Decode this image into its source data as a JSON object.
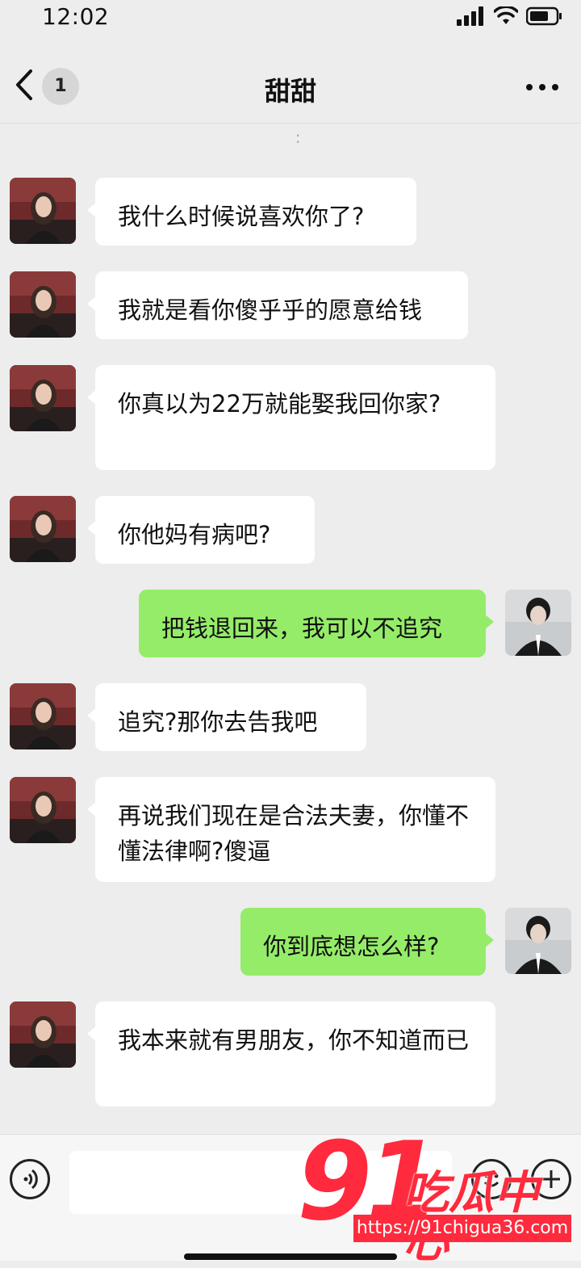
{
  "status_bar": {
    "time": "12:02"
  },
  "nav": {
    "title": "甜甜",
    "unread_count": "1"
  },
  "messages": [
    {
      "side": "left",
      "text": "我什么时候说喜欢你了?"
    },
    {
      "side": "left",
      "text": "我就是看你傻乎乎的愿意给钱"
    },
    {
      "side": "left",
      "text": "你真以为22万就能娶我回你家?"
    },
    {
      "side": "left",
      "text": "你他妈有病吧?"
    },
    {
      "side": "right",
      "text": "把钱退回来，我可以不追究"
    },
    {
      "side": "left",
      "text": "追究?那你去告我吧"
    },
    {
      "side": "left",
      "text": "再说我们现在是合法夫妻，你懂不懂法律啊?傻逼"
    },
    {
      "side": "right",
      "text": "你到底想怎么样?"
    },
    {
      "side": "left",
      "text": "我本来就有男朋友，你不知道而已"
    }
  ],
  "input_bar": {
    "placeholder": ""
  },
  "watermark": {
    "number": "91",
    "brand": "吃瓜中心",
    "url": "https://91chigua36.com"
  },
  "colors": {
    "background": "#ededed",
    "bubble_in": "#ffffff",
    "bubble_out": "#95ec69",
    "watermark": "#ff2a3d"
  },
  "icons": [
    "back-chevron-icon",
    "more-icon",
    "voice-icon",
    "emoji-icon",
    "plus-icon",
    "signal-icon",
    "wifi-icon",
    "battery-icon"
  ]
}
